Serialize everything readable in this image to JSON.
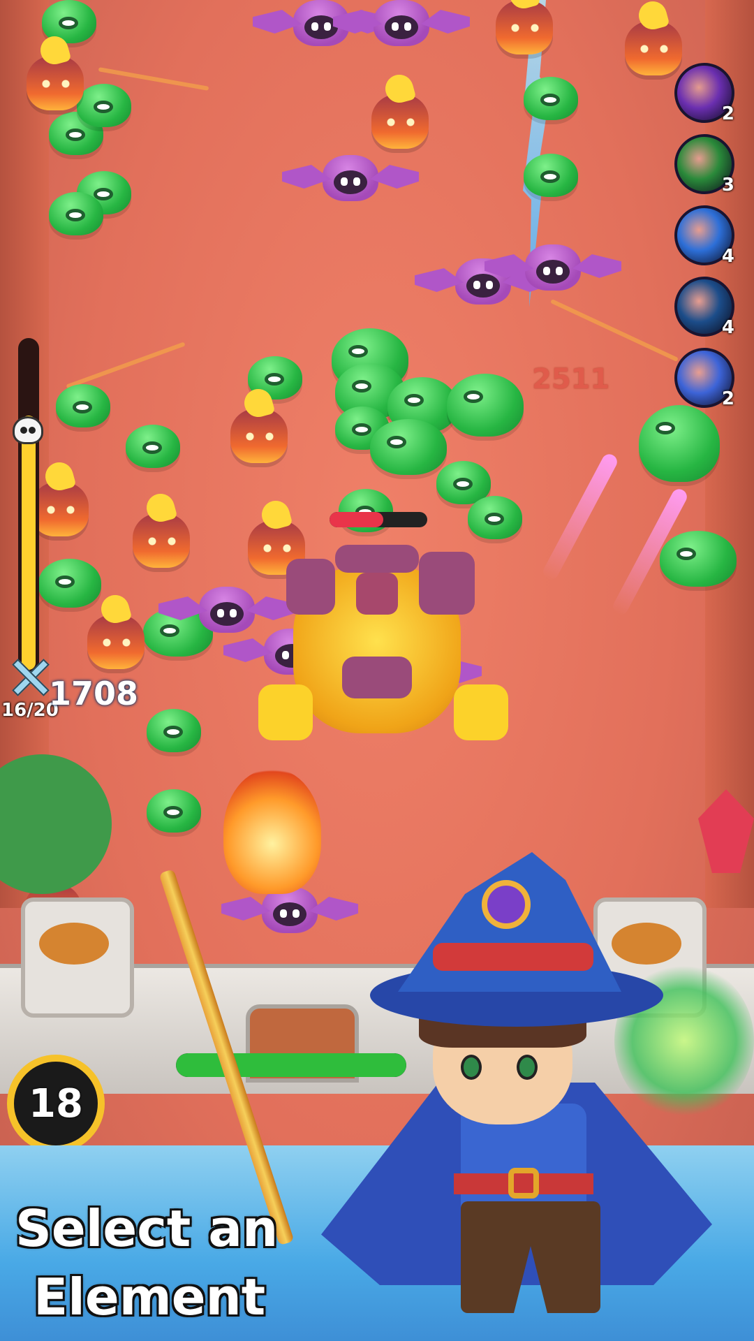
{
  "boss": {
    "hp_fraction": 0.55,
    "hp_color": "#e9344a"
  },
  "damage_popup": "2511",
  "skills": [
    {
      "icon": "purple-slash-icon",
      "level": "2",
      "color": "#6b2fb0"
    },
    {
      "icon": "green-vortex-icon",
      "level": "3",
      "color": "#2a8a3a"
    },
    {
      "icon": "ice-star-icon",
      "level": "4",
      "color": "#2d6fd8"
    },
    {
      "icon": "wind-blade-icon",
      "level": "4",
      "color": "#1c4d8a"
    },
    {
      "icon": "lightning-burst-icon",
      "level": "2",
      "color": "#3d64d8"
    }
  ],
  "wave": {
    "progress_fraction": 0.78,
    "count": "16/20"
  },
  "coins": "1708",
  "castle": {
    "hp_fraction": 1.0,
    "hp_color": "#2fbd3c"
  },
  "timer": "18",
  "headline": {
    "line1": "Select an",
    "line2": "Element"
  }
}
